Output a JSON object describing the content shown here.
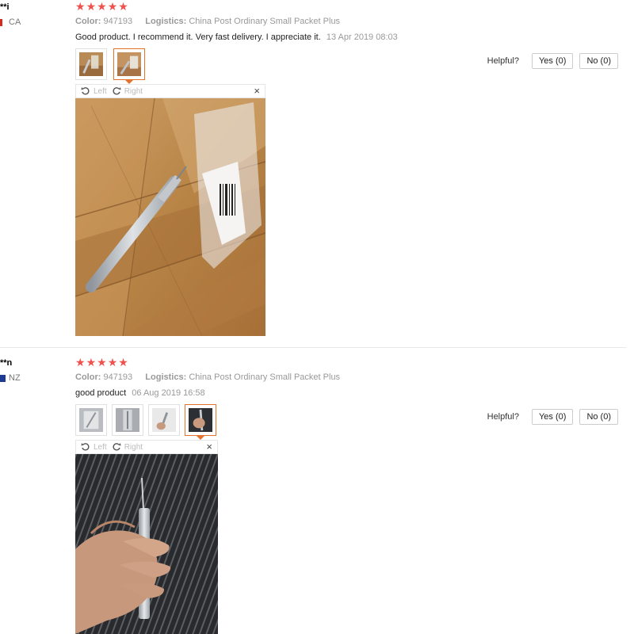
{
  "reviews": [
    {
      "user": "**i",
      "country": "CA",
      "stars": 5,
      "color_label": "Color:",
      "color_value": "947193",
      "logistics_label": "Logistics:",
      "logistics_value": "China Post Ordinary Small Packet Plus",
      "comment": "Good product. I recommend it. Very fast delivery. I appreciate it.",
      "date": "13 Apr 2019 08:03",
      "thumbnail_count": 2,
      "active_thumbnail": 2,
      "rotate_left": "Left",
      "rotate_right": "Right",
      "close": "×",
      "helpful_label": "Helpful?",
      "yes_label": "Yes (0)",
      "no_label": "No (0)"
    },
    {
      "user": "**n",
      "country": "NZ",
      "stars": 5,
      "color_label": "Color:",
      "color_value": "947193",
      "logistics_label": "Logistics:",
      "logistics_value": "China Post Ordinary Small Packet Plus",
      "comment": "good product",
      "date": "06 Aug 2019 16:58",
      "thumbnail_count": 4,
      "active_thumbnail": 4,
      "rotate_left": "Left",
      "rotate_right": "Right",
      "close": "×",
      "helpful_label": "Helpful?",
      "yes_label": "Yes (0)",
      "no_label": "No (0)"
    }
  ],
  "colors": {
    "star": "#f0514c",
    "accent": "#e6732d",
    "muted_text": "#999999"
  }
}
